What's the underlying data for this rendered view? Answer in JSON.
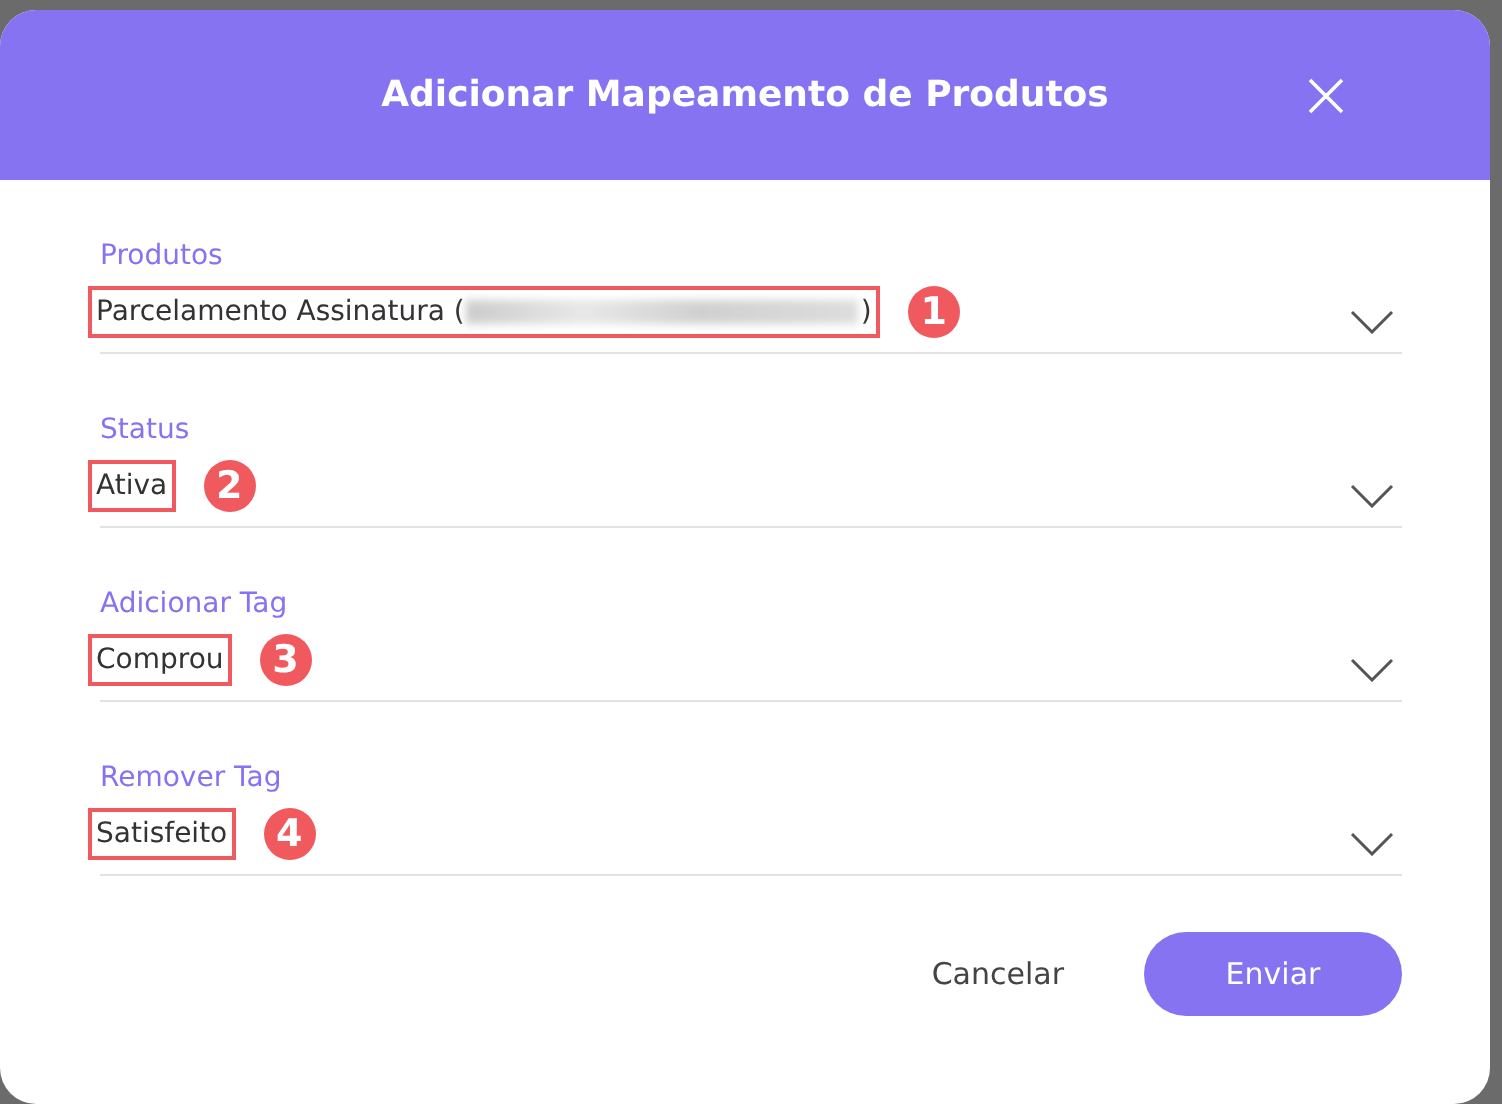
{
  "dialog": {
    "title": "Adicionar Mapeamento de Produtos"
  },
  "fields": [
    {
      "label": "Produtos",
      "value": "Parcelamento Assinatura (",
      "redacted": true,
      "value_end": ")",
      "marker": "1"
    },
    {
      "label": "Status",
      "value": "Ativa",
      "redacted": false,
      "marker": "2"
    },
    {
      "label": "Adicionar Tag",
      "value": "Comprou",
      "redacted": false,
      "marker": "3"
    },
    {
      "label": "Remover Tag",
      "value": "Satisfeito",
      "redacted": false,
      "marker": "4"
    }
  ],
  "buttons": {
    "cancel": "Cancelar",
    "submit": "Enviar"
  }
}
